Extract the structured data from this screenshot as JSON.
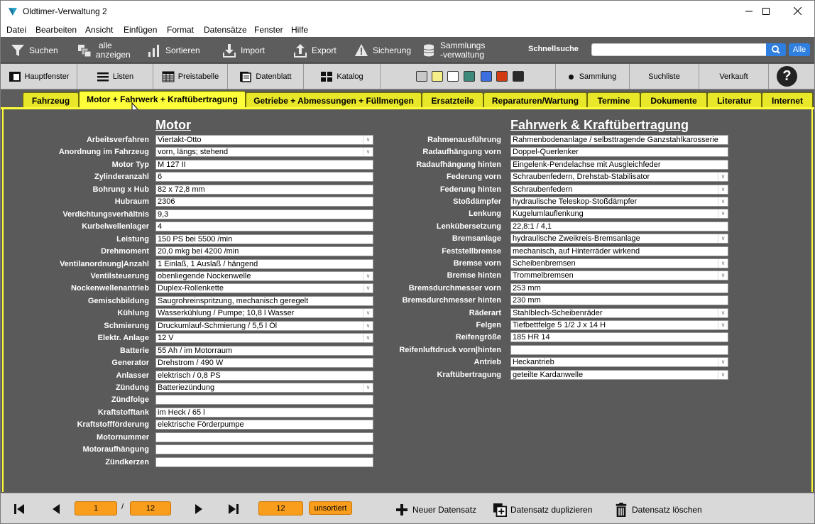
{
  "window": {
    "title": "Oldtimer-Verwaltung 2",
    "min": "—",
    "max": "☐",
    "close": "✕"
  },
  "menu": [
    "Datei",
    "Bearbeiten",
    "Ansicht",
    "Einfügen",
    "Format",
    "Datensätze",
    "Fenster",
    "Hilfe"
  ],
  "toolbar1": {
    "search": "Suchen",
    "show_all_1": "alle",
    "show_all_2": "anzeigen",
    "sort": "Sortieren",
    "import": "Import",
    "export": "Export",
    "backup": "Sicherung",
    "collection_1": "Sammlungs",
    "collection_2": "-verwaltung",
    "quick_search_label": "Schnellsuche",
    "quick_search_value": "",
    "all_button": "Alle"
  },
  "toolbar2": {
    "main_window": "Hauptfenster",
    "lists": "Listen",
    "price_table": "Preistabelle",
    "data_sheet": "Datenblatt",
    "catalog": "Katalog",
    "swatches": [
      "#c8c8c8",
      "#f6f08a",
      "#ffffff",
      "#3d8a7a",
      "#3c6fe0",
      "#d23b12",
      "#2a2a2a"
    ],
    "collection": "Sammlung",
    "search_list": "Suchliste",
    "sold": "Verkauft",
    "help": "?"
  },
  "tabs": [
    "Fahrzeug",
    "Motor + Fahrwerk + Kraftübertragung",
    "Getriebe + Abmessungen + Füllmengen",
    "Ersatzteile",
    "Reparaturen/Wartung",
    "Termine",
    "Dokumente",
    "Literatur",
    "Internet"
  ],
  "motor": {
    "title": "Motor",
    "fields": [
      {
        "label": "Arbeitsverfahren",
        "value": "Viertakt-Otto",
        "dropdown": true
      },
      {
        "label": "Anordnung im Fahrzeug",
        "value": "vorn, längs; stehend",
        "dropdown": true
      },
      {
        "label": "Motor Typ",
        "value": "M 127 II",
        "dropdown": false
      },
      {
        "label": "Zylinderanzahl",
        "value": "6",
        "dropdown": false
      },
      {
        "label": "Bohrung x Hub",
        "value": "82 x 72,8 mm",
        "dropdown": false
      },
      {
        "label": "Hubraum",
        "value": "2306",
        "dropdown": false
      },
      {
        "label": "Verdichtungsverhältnis",
        "value": "9,3",
        "dropdown": false
      },
      {
        "label": "Kurbelwellenlager",
        "value": "4",
        "dropdown": false
      },
      {
        "label": "Leistung",
        "value": "150 PS bei 5500 /min",
        "dropdown": false
      },
      {
        "label": "Drehmoment",
        "value": "20,0 mkg bei 4200 /min",
        "dropdown": false
      },
      {
        "label": "Ventilanordnung|Anzahl",
        "value": "1 Einlaß, 1 Auslaß / hängend",
        "dropdown": false
      },
      {
        "label": "Ventilsteuerung",
        "value": "obenliegende Nockenwelle",
        "dropdown": true
      },
      {
        "label": "Nockenwellenantrieb",
        "value": "Duplex-Rollenkette",
        "dropdown": true
      },
      {
        "label": "Gemischbildung",
        "value": "Saugrohreinspritzung, mechanisch geregelt",
        "dropdown": false
      },
      {
        "label": "Kühlung",
        "value": "Wasserkühlung / Pumpe; 10,8 l Wasser",
        "dropdown": true
      },
      {
        "label": "Schmierung",
        "value": "Druckumlauf-Schmierung / 5,5 l Öl",
        "dropdown": true
      },
      {
        "label": "Elektr. Anlage",
        "value": "12 V",
        "dropdown": true
      },
      {
        "label": "Batterie",
        "value": "55 Ah / im Motorraum",
        "dropdown": false
      },
      {
        "label": "Generator",
        "value": "Drehstrom / 490 W",
        "dropdown": false
      },
      {
        "label": "Anlasser",
        "value": "elektrisch / 0,8 PS",
        "dropdown": false
      },
      {
        "label": "Zündung",
        "value": "Batteriezündung",
        "dropdown": true
      },
      {
        "label": "Zündfolge",
        "value": "",
        "dropdown": false
      },
      {
        "label": "Kraftstofftank",
        "value": "im Heck / 65 l",
        "dropdown": false
      },
      {
        "label": "Kraftstoffförderung",
        "value": "elektrische Förderpumpe",
        "dropdown": false
      },
      {
        "label": "Motornummer",
        "value": "",
        "dropdown": false
      },
      {
        "label": "Motoraufhängung",
        "value": "",
        "dropdown": false
      },
      {
        "label": "Zündkerzen",
        "value": "",
        "dropdown": false
      }
    ]
  },
  "chassis": {
    "title": "Fahrwerk & Kraftübertragung",
    "fields": [
      {
        "label": "Rahmenausführung",
        "value": "Rahmenbodenanlage / selbsttragende Ganzstahlkarosserie",
        "dropdown": false
      },
      {
        "label": "Radaufhängung vorn",
        "value": "Doppel-Querlenker",
        "dropdown": false
      },
      {
        "label": "Radaufhängung hinten",
        "value": "Eingelenk-Pendelachse mit Ausgleichfeder",
        "dropdown": false
      },
      {
        "label": "Federung vorn",
        "value": "Schraubenfedern, Drehstab-Stabilisator",
        "dropdown": true
      },
      {
        "label": "Federung hinten",
        "value": "Schraubenfedern",
        "dropdown": true
      },
      {
        "label": "Stoßdämpfer",
        "value": "hydraulische Teleskop-Stoßdämpfer",
        "dropdown": true
      },
      {
        "label": "Lenkung",
        "value": "Kugelumlauflenkung",
        "dropdown": true
      },
      {
        "label": "Lenkübersetzung",
        "value": "22,8:1 / 4,1",
        "dropdown": false
      },
      {
        "label": "Bremsanlage",
        "value": "hydraulische Zweikreis-Bremsanlage",
        "dropdown": true
      },
      {
        "label": "Feststellbremse",
        "value": "mechanisch, auf Hinterräder wirkend",
        "dropdown": false
      },
      {
        "label": "Bremse vorn",
        "value": "Scheibenbremsen",
        "dropdown": true
      },
      {
        "label": "Bremse hinten",
        "value": "Trommelbremsen",
        "dropdown": true
      },
      {
        "label": "Bremsdurchmesser vorn",
        "value": "253 mm",
        "dropdown": false
      },
      {
        "label": "Bremsdurchmesser hinten",
        "value": "230 mm",
        "dropdown": false
      },
      {
        "label": "Räderart",
        "value": "Stahlblech-Scheibenräder",
        "dropdown": true
      },
      {
        "label": "Felgen",
        "value": "Tiefbettfelge 5 1/2 J x 14 H",
        "dropdown": true
      },
      {
        "label": "Reifengröße",
        "value": "185 HR 14",
        "dropdown": false
      },
      {
        "label": "Reifenluftdruck vorn|hinten",
        "value": "",
        "dropdown": false
      },
      {
        "label": "Antrieb",
        "value": "Heckantrieb",
        "dropdown": true
      },
      {
        "label": "Kraftübertragung",
        "value": "geteilte Kardanwelle",
        "dropdown": true
      }
    ]
  },
  "bottom": {
    "current_record": "1",
    "separator": "/",
    "total_records": "12",
    "found_records": "12",
    "sort_state": "unsortiert",
    "new_record": "Neuer Datensatz",
    "duplicate_record": "Datensatz duplizieren",
    "delete_record": "Datensatz löschen"
  }
}
